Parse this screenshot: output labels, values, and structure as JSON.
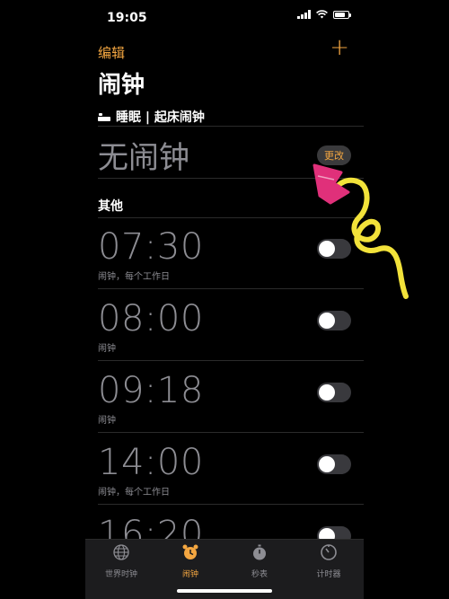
{
  "status_bar": {
    "time": "19:05"
  },
  "header": {
    "edit_label": "编辑",
    "add_label": "+",
    "title": "闹钟"
  },
  "sleep": {
    "label": "睡眠 | 起床闹钟",
    "no_alarm": "无闹钟",
    "change_label": "更改"
  },
  "section": {
    "other_label": "其他"
  },
  "alarms": [
    {
      "time": "07:30",
      "sub": "闹钟，每个工作日",
      "enabled": false
    },
    {
      "time": "08:00",
      "sub": "闹钟",
      "enabled": false
    },
    {
      "time": "09:18",
      "sub": "闹钟",
      "enabled": false
    },
    {
      "time": "14:00",
      "sub": "闹钟，每个工作日",
      "enabled": false
    },
    {
      "time": "16:20",
      "sub": "",
      "enabled": false
    }
  ],
  "tabs": [
    {
      "label": "世界时钟",
      "icon": "globe-icon"
    },
    {
      "label": "闹钟",
      "icon": "alarm-clock-icon",
      "active": true
    },
    {
      "label": "秒表",
      "icon": "stopwatch-icon"
    },
    {
      "label": "计时器",
      "icon": "timer-icon"
    }
  ],
  "colors": {
    "accent": "#f3a641",
    "annotation_pink": "#e0307a",
    "annotation_yellow": "#f2e23a"
  }
}
